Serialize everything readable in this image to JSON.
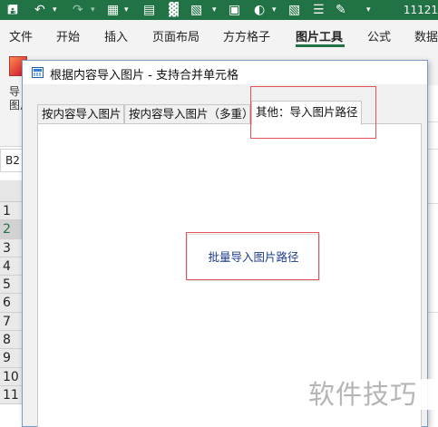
{
  "excel": {
    "title_fragment": "11121",
    "ribbon_tabs": [
      "文件",
      "开始",
      "插入",
      "页面布局",
      "方方格子",
      "图片工具",
      "公式",
      "数据"
    ],
    "active_ribbon_tab": "图片工具",
    "ribbon_group_label": "导\n图片",
    "name_box": "B2",
    "row_numbers": [
      "1",
      "2",
      "3",
      "4",
      "5",
      "6",
      "7",
      "8",
      "9",
      "10",
      "11"
    ],
    "selected_row": "2",
    "accent_color": "#217346"
  },
  "dialog": {
    "title": "根据内容导入图片 - 支持合并单元格",
    "tabs": [
      {
        "label": "按内容导入图片",
        "active": false
      },
      {
        "label": "按内容导入图片（多重）",
        "active": false
      },
      {
        "label": "其他：导入图片路径",
        "active": true
      }
    ],
    "batch_button_label": "批量导入图片路径",
    "highlight_color": "#e0545a"
  },
  "watermark": "软件技巧"
}
